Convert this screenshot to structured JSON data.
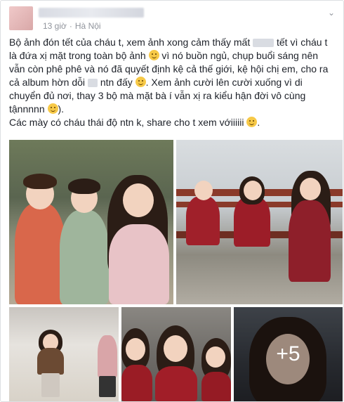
{
  "post": {
    "time": "13 giờ",
    "separator": "·",
    "location": "Hà Nội",
    "text_lines": [
      "Bộ ảnh đón tết của cháu t, xem ảnh xong cảm thấy mất",
      "tết vì cháu t là đứa xị mặt trong toàn bộ ảnh",
      "vì nó buồn ngủ, chụp buổi sáng nên vẫn còn phê phê và nó đã quyết định kệ cả thế giới, kệ hội chị em, cho ra cả album hờn dỗi",
      "ntn đấy",
      "Xem ảnh cười lên cười xuống vì di chuyển đủ nơi, thay 3 bộ mà mặt bà í vẫn xị ra kiểu hận đời vô cùng tậnnnnn",
      ").",
      "Các mày có cháu thái độ ntn k, share cho t xem vớiiiiii"
    ],
    "more_photos": "+5"
  },
  "colors": {
    "meta_text": "#90949c",
    "body_text": "#1d2129",
    "border": "#dddfe2"
  },
  "icons": [
    "globe-icon",
    "chevron-down-icon",
    "smile-emoji-icon"
  ]
}
